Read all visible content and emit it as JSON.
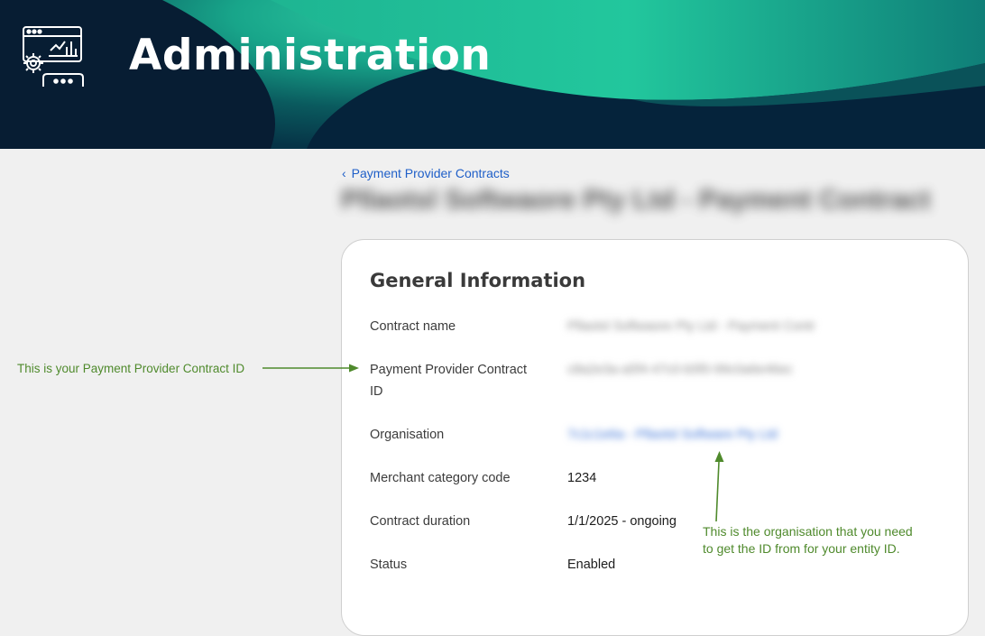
{
  "header": {
    "title": "Administration",
    "logo_icon": "admin-dashboard-gear-icon",
    "colors": {
      "navy": "#04223a",
      "teal": "#1fb08f"
    }
  },
  "breadcrumb": {
    "icon": "chevron-left-icon",
    "label": "Payment Provider Contracts"
  },
  "page": {
    "title_redacted": "Pllaotsl Softwaore Pty Ltd - Payment Contract"
  },
  "card": {
    "title": "General Information",
    "rows": [
      {
        "label": "Contract name",
        "value": "Pllaotsl Softwaore Pty Ltd - Payment Contr"
      },
      {
        "label": "Payment Provider Contract ID",
        "value": "c8a2e3a-a5f4-47c0-b5f0-99c0a6e46ec"
      },
      {
        "label": "Organisation",
        "value": "7c1c1e6a - Pllaotsl Software Pty Ltd"
      },
      {
        "label": "Merchant category code",
        "value": "1234"
      },
      {
        "label": "Contract duration",
        "value": "1/1/2025 - ongoing"
      },
      {
        "label": "Status",
        "value": "Enabled"
      }
    ]
  },
  "annotations": {
    "left_note": "This is your Payment Provider Contract ID",
    "right_note_line1": "This is the organisation that you need",
    "right_note_line2": "to get the ID from for your entity ID.",
    "color": "#4f8a2c"
  }
}
